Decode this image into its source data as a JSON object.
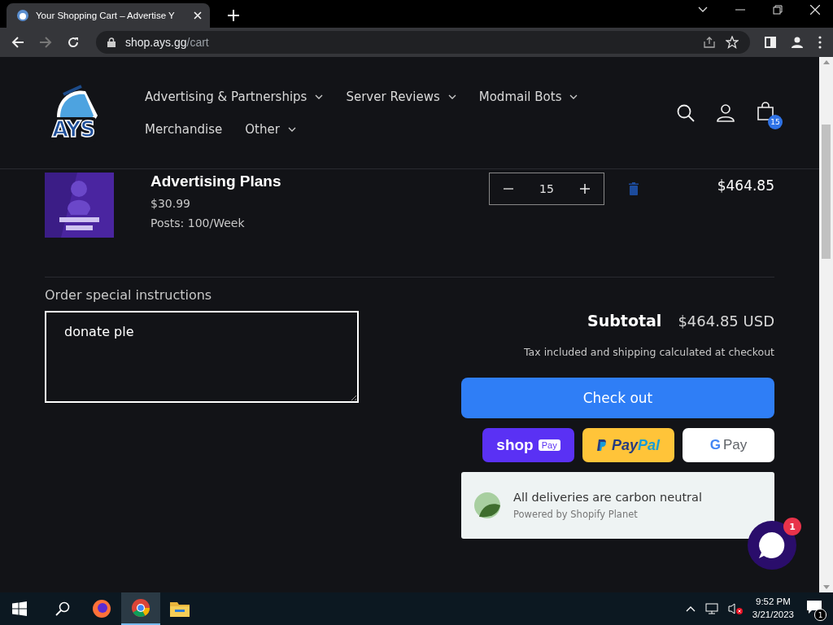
{
  "browser": {
    "tab_title": "Your Shopping Cart – Advertise Y",
    "url_host": "shop.ays.gg",
    "url_path": "/cart"
  },
  "header": {
    "logo": "AYS",
    "nav": [
      {
        "label": "Advertising & Partnerships",
        "dropdown": true
      },
      {
        "label": "Server Reviews",
        "dropdown": true
      },
      {
        "label": "Modmail Bots",
        "dropdown": true
      },
      {
        "label": "Merchandise",
        "dropdown": false
      },
      {
        "label": "Other",
        "dropdown": true
      }
    ],
    "cart_count": "15"
  },
  "cart_item": {
    "title": "Advertising Plans",
    "price": "$30.99",
    "option": "Posts: 100/Week",
    "quantity": "15",
    "total": "$464.85"
  },
  "instructions": {
    "label": "Order special instructions",
    "value": "donate ple"
  },
  "summary": {
    "subtotal_label": "Subtotal",
    "subtotal": "$464.85 USD",
    "note": "Tax included and shipping calculated at checkout",
    "checkout": "Check out"
  },
  "payments": [
    {
      "kind": "shop",
      "text": "shop",
      "badge": "Pay"
    },
    {
      "kind": "paypal",
      "text": "Pay",
      "accent": "Pal"
    },
    {
      "kind": "gpay",
      "mark": "G",
      "text": "Pay"
    }
  ],
  "planet": {
    "title": "All deliveries are carbon neutral",
    "subtitle": "Powered by Shopify Planet"
  },
  "chat": {
    "badge": "1"
  },
  "taskbar": {
    "time": "9:52 PM",
    "date": "3/21/2023",
    "notifications": "1",
    "apps": [
      {
        "kind": "firefox",
        "selected": false
      },
      {
        "kind": "chrome",
        "selected": true
      },
      {
        "kind": "files",
        "selected": false
      }
    ]
  }
}
